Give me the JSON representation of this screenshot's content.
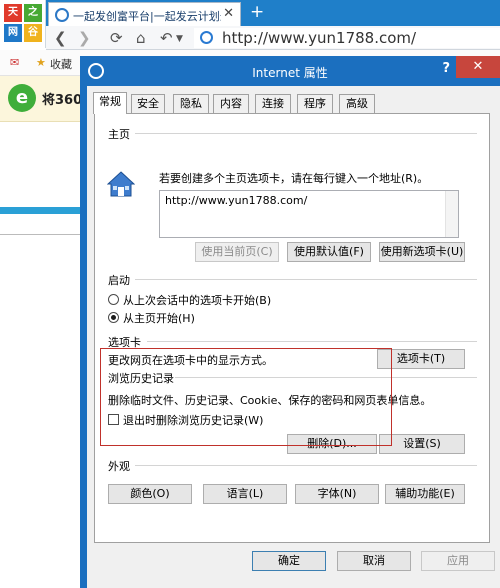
{
  "browser": {
    "logo_chars": [
      "天",
      "之",
      "网",
      "谷"
    ],
    "tab_title": "一起发创富平台|一起发云计划最新",
    "new_tab_symbol": "+",
    "url": "http://www.yun1788.com/",
    "favorites_label": "收藏",
    "banner_text": "将360"
  },
  "dialog": {
    "title": "Internet 属性",
    "help_symbol": "?",
    "close_symbol": "✕",
    "tabs": [
      "常规",
      "安全",
      "隐私",
      "内容",
      "连接",
      "程序",
      "高级"
    ],
    "homepage": {
      "heading": "主页",
      "instruction": "若要创建多个主页选项卡，请在每行键入一个地址(R)。",
      "value": "http://www.yun1788.com/",
      "btn_use_current": "使用当前页(C)",
      "btn_use_default": "使用默认值(F)",
      "btn_use_newtab": "使用新选项卡(U)"
    },
    "startup": {
      "heading": "启动",
      "option1": "从上次会话中的选项卡开始(B)",
      "option2": "从主页开始(H)",
      "selected": 2
    },
    "tabs_section": {
      "heading": "选项卡",
      "description": "更改网页在选项卡中的显示方式。",
      "button": "选项卡(T)"
    },
    "history": {
      "heading": "浏览历史记录",
      "description": "删除临时文件、历史记录、Cookie、保存的密码和网页表单信息。",
      "checkbox_label": "退出时删除浏览历史记录(W)",
      "checked": false,
      "btn_delete": "删除(D)...",
      "btn_settings": "设置(S)"
    },
    "appearance": {
      "heading": "外观",
      "btn_colors": "颜色(O)",
      "btn_languages": "语言(L)",
      "btn_fonts": "字体(N)",
      "btn_accessibility": "辅助功能(E)"
    },
    "footer": {
      "ok": "确定",
      "cancel": "取消",
      "apply": "应用"
    }
  }
}
